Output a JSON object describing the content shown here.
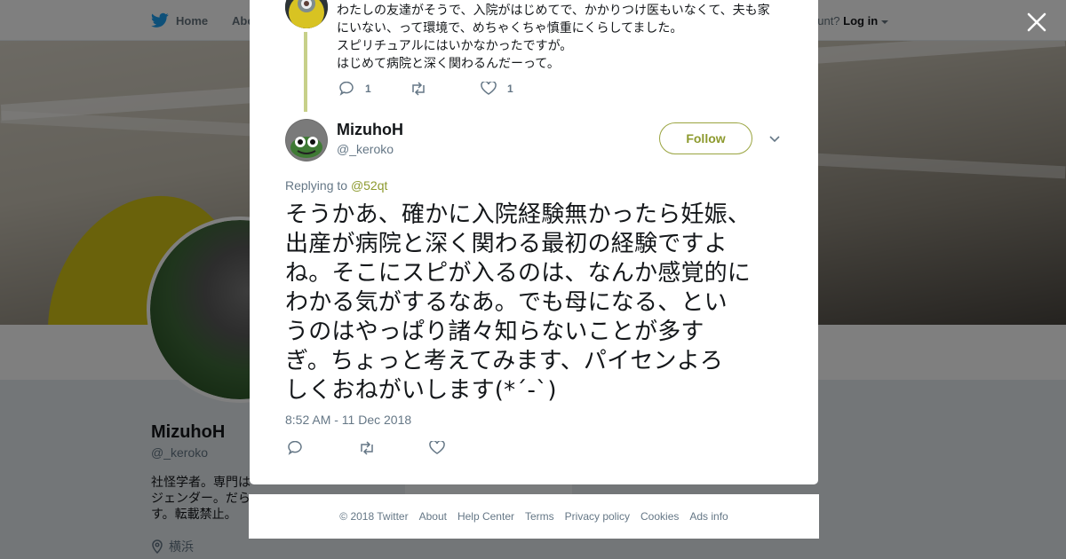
{
  "topbar": {
    "home_label": "Home",
    "about_label": "Abo",
    "account_prompt": "ccount?",
    "login_label": "Log in"
  },
  "profile": {
    "name": "MizuhoH",
    "handle": "@_keroko",
    "bio": "社怪学者。専門は医療社会学とジェンダー。だら...す。転載禁止。",
    "bio_line1": "社怪学者。専門は",
    "bio_line2": "ジェンダー。だら",
    "bio_line3": "す。転載禁止。",
    "location": "横浜"
  },
  "previous_tweet": {
    "lines": [
      "わたしの友達がそうで、入院がはじめてで、かかりつけ医もいなくて、夫も家",
      "にいない、って環境で、めちゃくちゃ慎重にくらしてました。",
      "スピリチュアルにはいかなかったですが。",
      "はじめて病院と深く関わるんだーって。"
    ],
    "reply_count": "1",
    "retweet_count": "",
    "like_count": "1"
  },
  "tweet": {
    "author_name": "MizuhoH",
    "author_handle": "@_keroko",
    "follow_label": "Follow",
    "replying_prefix": "Replying to",
    "replying_to": "@52qt",
    "text_lines": [
      "そうかあ、確かに入院経験無かったら妊娠、",
      "出産が病院と深く関わる最初の経験ですよ",
      "ね。そこにスピが入るのは、なんか感覚的に",
      "わかる気がするなあ。でも母になる、とい",
      "うのはやっぱり諸々知らないことが多す",
      "ぎ。ちょっと考えてみます、パイセンよろ",
      "しくおねがいします(*´-`)"
    ],
    "timestamp": "8:52 AM - 11 Dec 2018"
  },
  "footer": {
    "links": [
      "© 2018 Twitter",
      "About",
      "Help Center",
      "Terms",
      "Privacy policy",
      "Cookies",
      "Ads info"
    ]
  },
  "colors": {
    "accent": "#8d9a2e",
    "thread_line": "#c7d089",
    "text_primary": "#14171a",
    "text_secondary": "#657786"
  },
  "icons": [
    "twitter-bird-icon",
    "caret-down-icon",
    "close-icon",
    "reply-icon",
    "retweet-icon",
    "like-icon",
    "chevron-down-icon",
    "location-pin-icon"
  ]
}
